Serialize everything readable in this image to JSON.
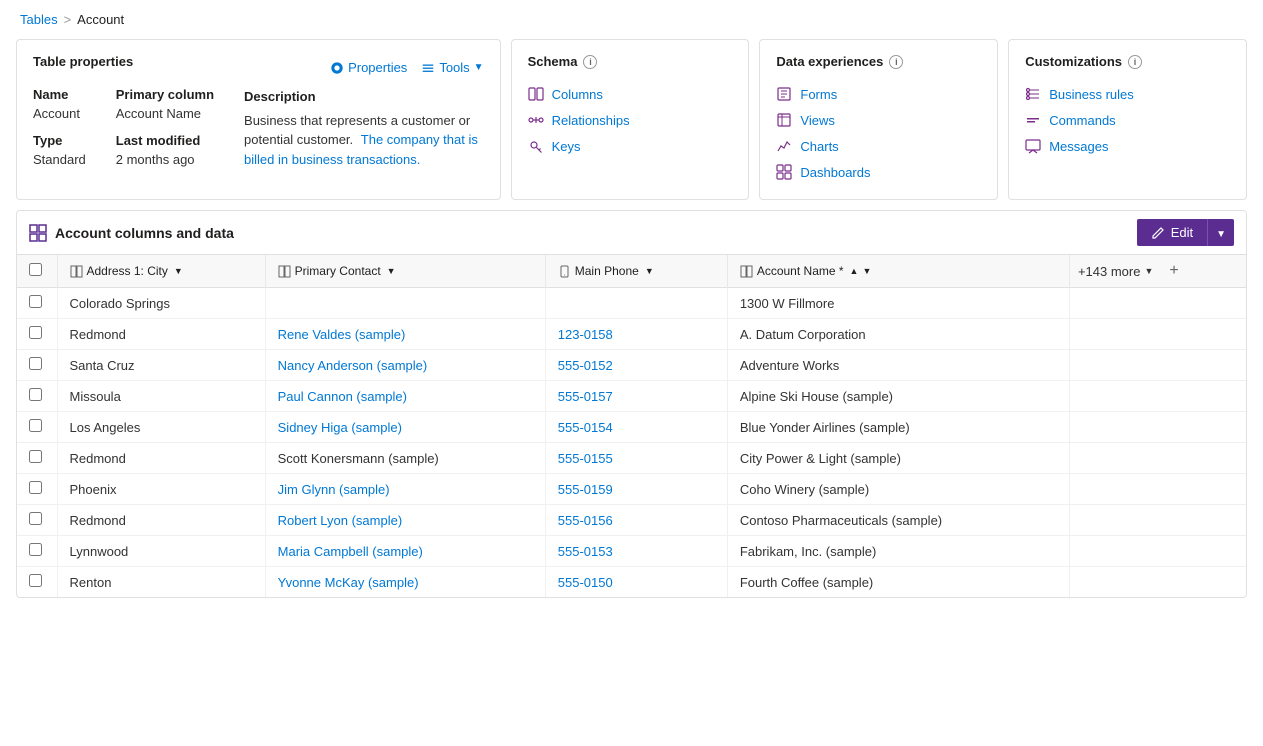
{
  "breadcrumb": {
    "parent": "Tables",
    "separator": ">",
    "current": "Account"
  },
  "tableProperties": {
    "sectionTitle": "Table properties",
    "propertiesLink": "Properties",
    "toolsLink": "Tools",
    "columns": [
      {
        "label": "Name",
        "value": "Account"
      },
      {
        "label": "Primary column",
        "value": "Account Name"
      },
      {
        "label": "Description",
        "value": ""
      },
      {
        "label": "Type",
        "value": ""
      },
      {
        "label": "Last modified",
        "value": ""
      },
      {
        "label": "Standard",
        "value": ""
      }
    ],
    "nameLabel": "Name",
    "nameValue": "Account",
    "primaryColumnLabel": "Primary column",
    "primaryColumnValue": "Account Name",
    "descriptionLabel": "Description",
    "descriptionText1": "Business that represents a customer or potential customer.",
    "descriptionLink": "The company that is billed in business transactions.",
    "typeLabel": "Type",
    "typeValue": "Standard",
    "lastModifiedLabel": "Last modified",
    "lastModifiedValue": "2 months ago"
  },
  "schema": {
    "title": "Schema",
    "links": [
      {
        "label": "Columns",
        "icon": "columns"
      },
      {
        "label": "Relationships",
        "icon": "relationships"
      },
      {
        "label": "Keys",
        "icon": "keys"
      }
    ]
  },
  "dataExperiences": {
    "title": "Data experiences",
    "links": [
      {
        "label": "Forms",
        "icon": "forms"
      },
      {
        "label": "Views",
        "icon": "views"
      },
      {
        "label": "Charts",
        "icon": "charts"
      },
      {
        "label": "Dashboards",
        "icon": "dashboards"
      }
    ]
  },
  "customizations": {
    "title": "Customizations",
    "links": [
      {
        "label": "Business rules",
        "icon": "business-rules"
      },
      {
        "label": "Commands",
        "icon": "commands"
      },
      {
        "label": "Messages",
        "icon": "messages"
      }
    ]
  },
  "dataGrid": {
    "sectionTitle": "Account columns and data",
    "editLabel": "Edit",
    "columns": [
      {
        "label": "Address 1: City",
        "hasDropdown": true
      },
      {
        "label": "Primary Contact",
        "hasDropdown": true
      },
      {
        "label": "Main Phone",
        "hasDropdown": true
      },
      {
        "label": "Account Name *",
        "hasSort": true,
        "hasDropdown": true
      },
      {
        "label": "+143 more",
        "isMore": true
      }
    ],
    "rows": [
      {
        "city": "Colorado Springs",
        "contact": "",
        "phone": "",
        "account": "1300 W Fillmore",
        "contactIsLink": false
      },
      {
        "city": "Redmond",
        "contact": "Rene Valdes (sample)",
        "phone": "123-0158",
        "account": "A. Datum Corporation",
        "contactIsLink": true
      },
      {
        "city": "Santa Cruz",
        "contact": "Nancy Anderson (sample)",
        "phone": "555-0152",
        "account": "Adventure Works",
        "contactIsLink": true
      },
      {
        "city": "Missoula",
        "contact": "Paul Cannon (sample)",
        "phone": "555-0157",
        "account": "Alpine Ski House (sample)",
        "contactIsLink": true
      },
      {
        "city": "Los Angeles",
        "contact": "Sidney Higa (sample)",
        "phone": "555-0154",
        "account": "Blue Yonder Airlines (sample)",
        "contactIsLink": true
      },
      {
        "city": "Redmond",
        "contact": "Scott Konersmann (sample)",
        "phone": "555-0155",
        "account": "City Power & Light (sample)",
        "contactIsLink": false
      },
      {
        "city": "Phoenix",
        "contact": "Jim Glynn (sample)",
        "phone": "555-0159",
        "account": "Coho Winery (sample)",
        "contactIsLink": true
      },
      {
        "city": "Redmond",
        "contact": "Robert Lyon (sample)",
        "phone": "555-0156",
        "account": "Contoso Pharmaceuticals (sample)",
        "contactIsLink": true
      },
      {
        "city": "Lynnwood",
        "contact": "Maria Campbell (sample)",
        "phone": "555-0153",
        "account": "Fabrikam, Inc. (sample)",
        "contactIsLink": true
      },
      {
        "city": "Renton",
        "contact": "Yvonne McKay (sample)",
        "phone": "555-0150",
        "account": "Fourth Coffee (sample)",
        "contactIsLink": true
      }
    ]
  }
}
